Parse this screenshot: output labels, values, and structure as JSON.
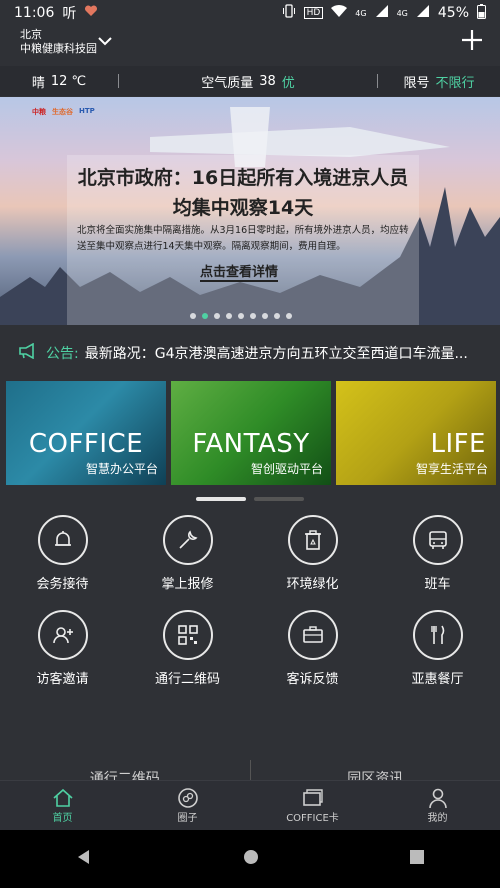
{
  "status_bar": {
    "time": "11:06",
    "carrier": "听",
    "battery": "45%",
    "net1": "4G",
    "net2": "4G",
    "hd": "HD"
  },
  "header": {
    "city": "北京",
    "park": "中粮健康科技园"
  },
  "weather": {
    "condition": "晴",
    "temp": "12 ℃",
    "aqi_label": "空气质量",
    "aqi_value": "38",
    "aqi_level": "优",
    "limit_label": "限号",
    "limit_value": "不限行"
  },
  "banner": {
    "headline_line1": "北京市政府：16日起所有入境进京人员",
    "headline_line2": "均集中观察14天",
    "desc": "北京将全面实施集中隔离措施。从3月16日零时起，所有境外进京人员，均应转送至集中观察点进行14天集中观察。隔离观察期间，费用自理。",
    "more": "点击查看详情",
    "logo1": "中粮",
    "logo2": "生态谷",
    "logo3": "HTP"
  },
  "notice": {
    "label": "公告:",
    "text": "最新路况：G4京港澳高速进京方向五环立交至西道口车流量..."
  },
  "cards": [
    {
      "title": "COFFICE",
      "subtitle": "智慧办公平台"
    },
    {
      "title": "FANTASY",
      "subtitle": "智创驱动平台"
    },
    {
      "title": "LIFE",
      "subtitle": "智享生活平台"
    }
  ],
  "services": [
    {
      "label": "会务接待",
      "icon": "bell-icon"
    },
    {
      "label": "掌上报修",
      "icon": "wrench-icon"
    },
    {
      "label": "环境绿化",
      "icon": "recycle-bin-icon"
    },
    {
      "label": "班车",
      "icon": "bus-icon"
    },
    {
      "label": "访客邀请",
      "icon": "add-user-icon"
    },
    {
      "label": "通行二维码",
      "icon": "qr-code-icon"
    },
    {
      "label": "客诉反馈",
      "icon": "briefcase-icon"
    },
    {
      "label": "亚惠餐厅",
      "icon": "cutlery-icon"
    }
  ],
  "bottom_cards": [
    "通行二维码",
    "园区资讯"
  ],
  "tabs": [
    {
      "label": "首页",
      "icon": "home-icon"
    },
    {
      "label": "圈子",
      "icon": "circle-icon"
    },
    {
      "label": "COFFICE卡",
      "icon": "card-icon"
    },
    {
      "label": "我的",
      "icon": "person-icon"
    }
  ],
  "colors": {
    "accent": "#4fd1a3",
    "background": "#2f3136"
  }
}
